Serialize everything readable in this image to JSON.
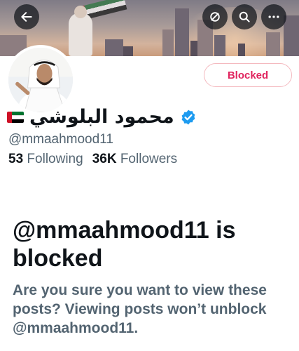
{
  "profile": {
    "display_name": "محمود البلوشي",
    "handle": "@mmaahmood11",
    "following_count": "53",
    "following_label": "Following",
    "followers_count": "36K",
    "followers_label": "Followers",
    "verified": true,
    "flag": "UAE"
  },
  "header": {
    "back_icon": "arrow-left-icon",
    "actions": [
      "circle-slash-icon",
      "search-icon",
      "more-horizontal-icon"
    ]
  },
  "blocked_button": {
    "label": "Blocked"
  },
  "blocked_notice": {
    "title": "@mmaahmood11 is blocked",
    "message": "Are you sure you want to view these posts? Viewing posts won’t unblock @mmaahmood11."
  },
  "colors": {
    "text_primary": "#0f1419",
    "text_secondary": "#536471",
    "blocked_red": "#e0245e",
    "verified_blue": "#1d9bf0"
  }
}
